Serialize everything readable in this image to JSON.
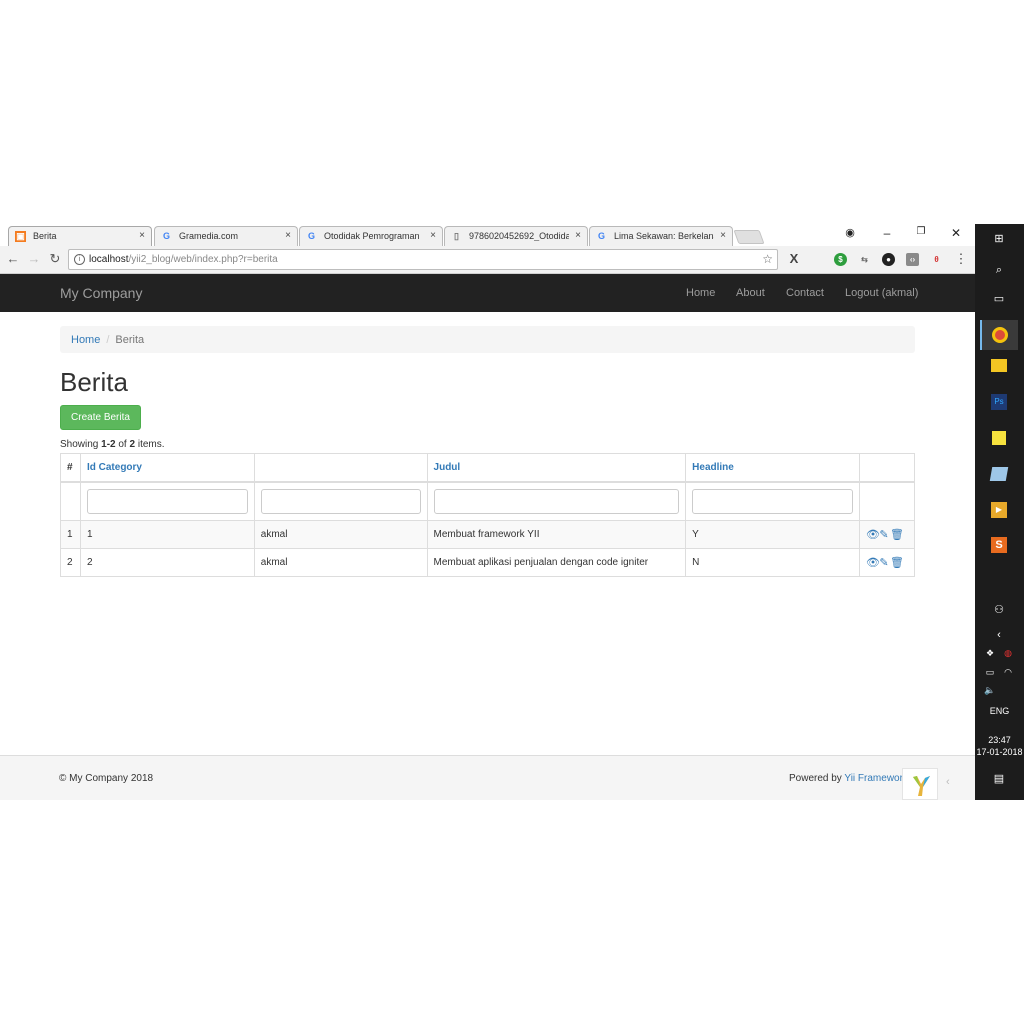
{
  "browser": {
    "tabs": [
      {
        "title": "Berita",
        "icon": "xampp-favicon",
        "active": true
      },
      {
        "title": "Gramedia.com",
        "icon": "google-g-favicon",
        "active": false
      },
      {
        "title": "Otodidak Pemrograman",
        "icon": "google-g-favicon",
        "active": false
      },
      {
        "title": "9786020452692_Otodida",
        "icon": "document-favicon",
        "active": false
      },
      {
        "title": "Lima Sekawan: Berkelana",
        "icon": "google-g-favicon",
        "active": false
      }
    ],
    "url_host": "localhost",
    "url_path": "/yii2_blog/web/index.php?r=berita",
    "tab_close": "×",
    "window_controls": {
      "minimize": "–",
      "restore": "❐",
      "close": "✕"
    }
  },
  "navbar": {
    "brand": "My Company",
    "links": [
      "Home",
      "About",
      "Contact",
      "Logout (akmal)"
    ]
  },
  "breadcrumb": {
    "home": "Home",
    "separator": "/",
    "current": "Berita"
  },
  "page": {
    "title": "Berita",
    "create_button": "Create Berita",
    "summary": {
      "prefix": "Showing ",
      "range": "1-2",
      "of": " of ",
      "total": "2",
      "suffix": " items."
    }
  },
  "grid": {
    "headers": [
      "#",
      "Id Category",
      "",
      "Judul",
      "Headline",
      ""
    ],
    "rows": [
      {
        "num": "1",
        "id_category": "1",
        "author": "akmal",
        "judul": "Membuat framework YII",
        "headline": "Y"
      },
      {
        "num": "2",
        "id_category": "2",
        "author": "akmal",
        "judul": "Membuat aplikasi penjualan dengan code igniter",
        "headline": "N"
      }
    ]
  },
  "footer": {
    "copyright": "© My Company 2018",
    "powered_prefix": "Powered by ",
    "powered_link": "Yii Framework"
  },
  "taskbar": {
    "language": "ENG",
    "time": "23:47",
    "date": "17-01-2018"
  },
  "colors": {
    "navbar_bg": "#222222",
    "link": "#337ab7",
    "success": "#5cb85c",
    "taskbar_bg": "#1c1c1c"
  }
}
